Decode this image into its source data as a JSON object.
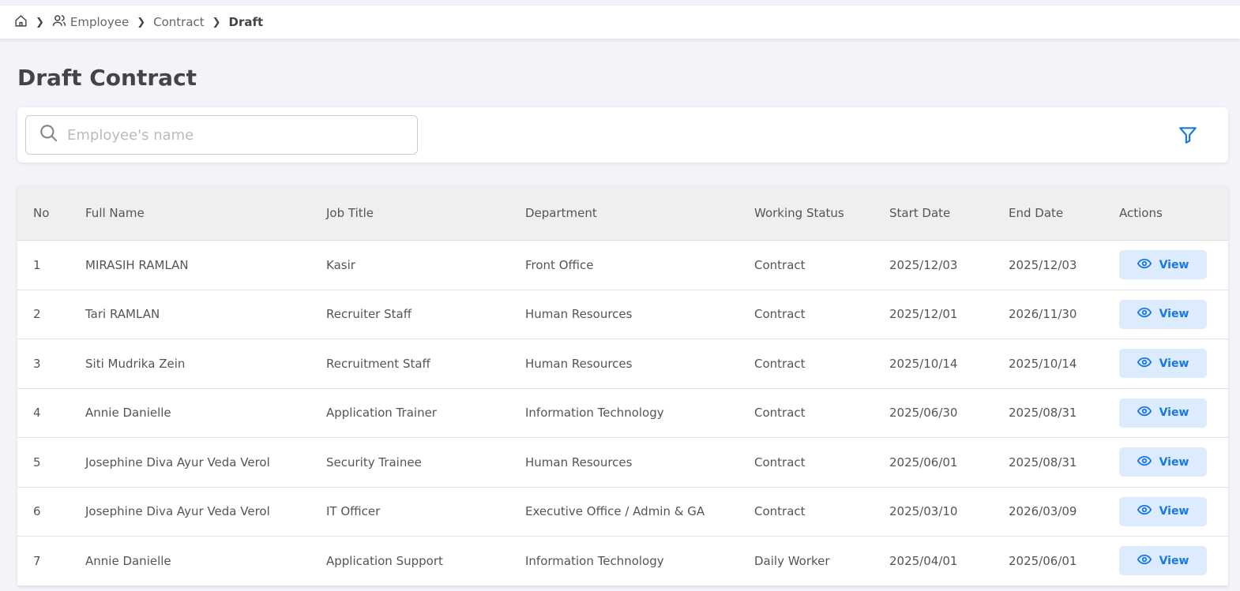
{
  "breadcrumb": {
    "items": [
      "Employee",
      "Contract"
    ],
    "current": "Draft"
  },
  "page_title": "Draft Contract",
  "search": {
    "placeholder": "Employee's name",
    "value": ""
  },
  "table": {
    "headers": [
      "No",
      "Full Name",
      "Job Title",
      "Department",
      "Working Status",
      "Start Date",
      "End Date",
      "Actions"
    ],
    "rows": [
      [
        "1",
        "MIRASIH RAMLAN",
        "Kasir",
        "Front Office",
        "Contract",
        "2025/12/03",
        "2025/12/03"
      ],
      [
        "2",
        "Tari RAMLAN",
        "Recruiter Staff",
        "Human Resources",
        "Contract",
        "2025/12/01",
        "2026/11/30"
      ],
      [
        "3",
        "Siti Mudrika Zein",
        "Recruitment Staff",
        "Human Resources",
        "Contract",
        "2025/10/14",
        "2025/10/14"
      ],
      [
        "4",
        "Annie Danielle",
        "Application Trainer",
        "Information Technology",
        "Contract",
        "2025/06/30",
        "2025/08/31"
      ],
      [
        "5",
        "Josephine Diva Ayur Veda Verol",
        "Security Trainee",
        "Human Resources",
        "Contract",
        "2025/06/01",
        "2025/08/31"
      ],
      [
        "6",
        "Josephine Diva Ayur Veda Verol",
        "IT Officer",
        "Executive Office / Admin & GA",
        "Contract",
        "2025/03/10",
        "2026/03/09"
      ],
      [
        "7",
        "Annie Danielle",
        "Application Support",
        "Information Technology",
        "Daily Worker",
        "2025/04/01",
        "2025/06/01"
      ]
    ],
    "view_label": "View"
  },
  "colors": {
    "accent": "#1677e6",
    "button_bg": "#dcebfd"
  }
}
